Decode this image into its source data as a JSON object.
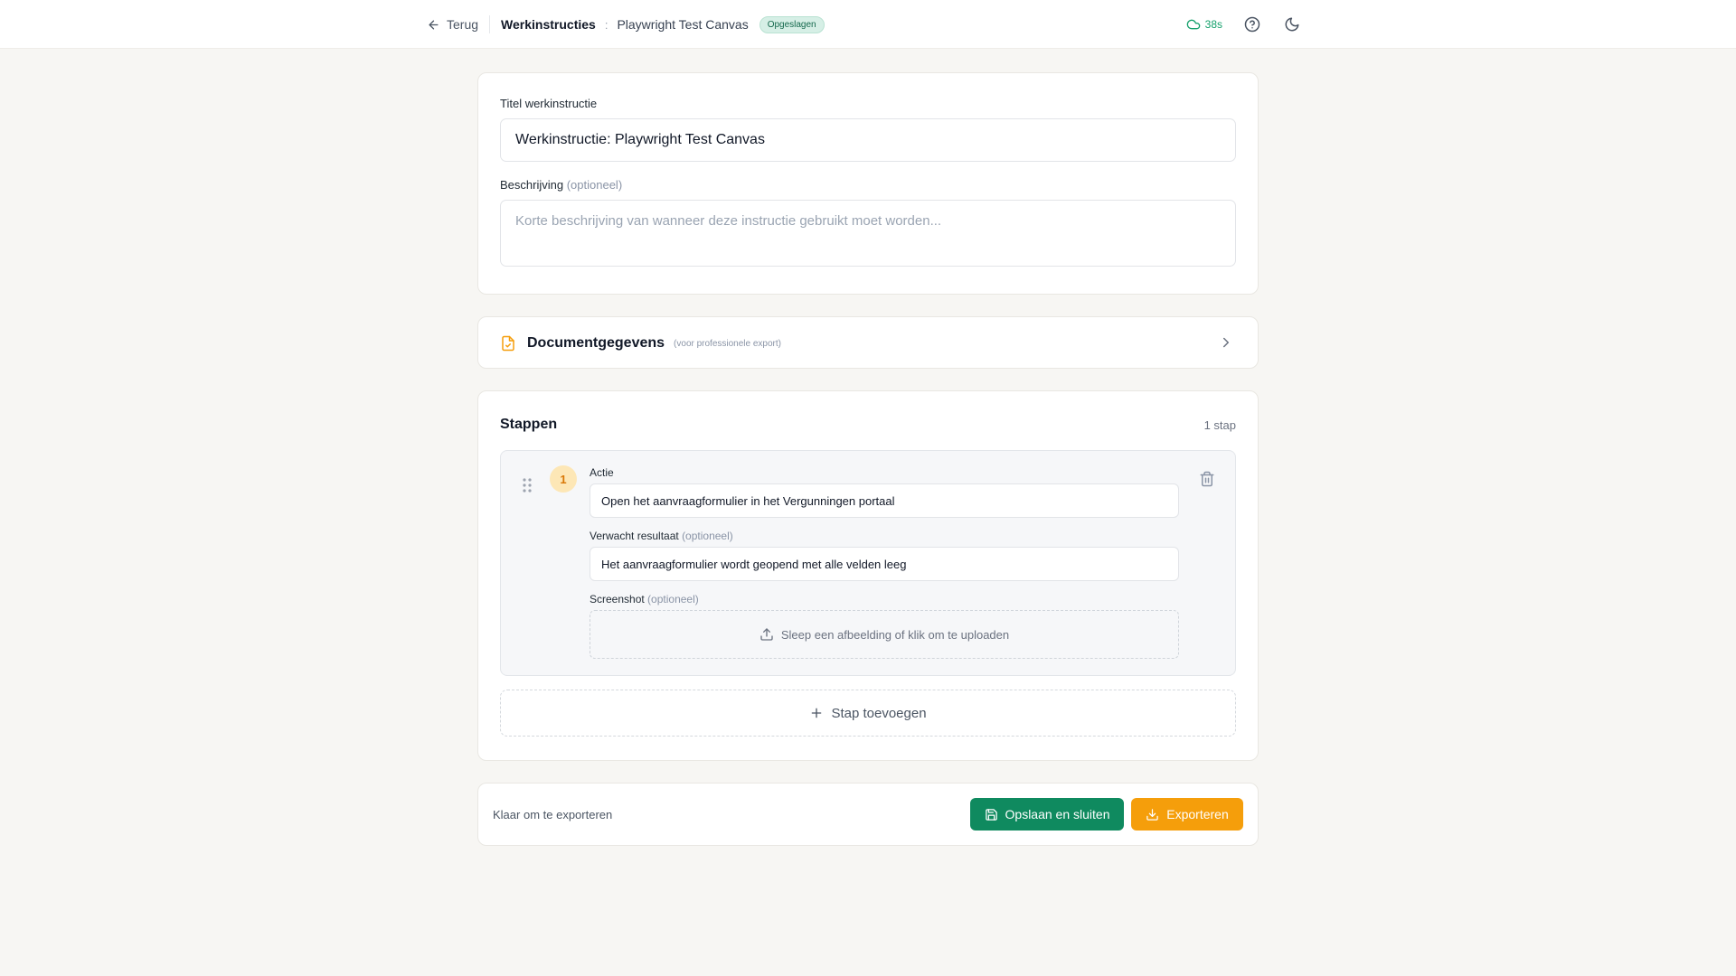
{
  "header": {
    "back_label": "Terug",
    "section": "Werkinstructies",
    "separator": ":",
    "document_name": "Playwright Test Canvas",
    "status_badge": "Opgeslagen",
    "autosave": "38s"
  },
  "form": {
    "title_label": "Titel werkinstructie",
    "title_value": "Werkinstructie: Playwright Test Canvas",
    "description_label": "Beschrijving",
    "optional": "(optioneel)",
    "description_placeholder": "Korte beschrijving van wanneer deze instructie gebruikt moet worden..."
  },
  "document_details": {
    "title": "Documentgegevens",
    "subtitle": "(voor professionele export)"
  },
  "steps": {
    "title": "Stappen",
    "count": "1 stap",
    "items": [
      {
        "number": "1",
        "action_label": "Actie",
        "action_value": "Open het aanvraagformulier in het Vergunningen portaal",
        "expected_label": "Verwacht resultaat",
        "expected_value": "Het aanvraagformulier wordt geopend met alle velden leeg",
        "screenshot_label": "Screenshot",
        "optional": "(optioneel)",
        "upload_text": "Sleep een afbeelding of klik om te uploaden"
      }
    ],
    "add_label": "Stap toevoegen"
  },
  "footer": {
    "status": "Klaar om te exporteren",
    "save_close_label": "Opslaan en sluiten",
    "export_label": "Exporteren"
  },
  "colors": {
    "primary_green": "#0f8a5f",
    "accent_orange": "#f59e0b",
    "badge_bg": "#d6efe6",
    "autosave_green": "#14a06b"
  },
  "icons": {
    "back": "arrow-left-icon",
    "autosave": "cloud-icon",
    "help": "help-circle-icon",
    "theme": "moon-icon",
    "document": "file-document-icon",
    "expand": "chevron-right-icon",
    "drag": "drag-handle-icon",
    "delete": "trash-icon",
    "upload": "upload-icon",
    "add": "plus-icon",
    "save": "save-icon",
    "export": "download-icon"
  }
}
